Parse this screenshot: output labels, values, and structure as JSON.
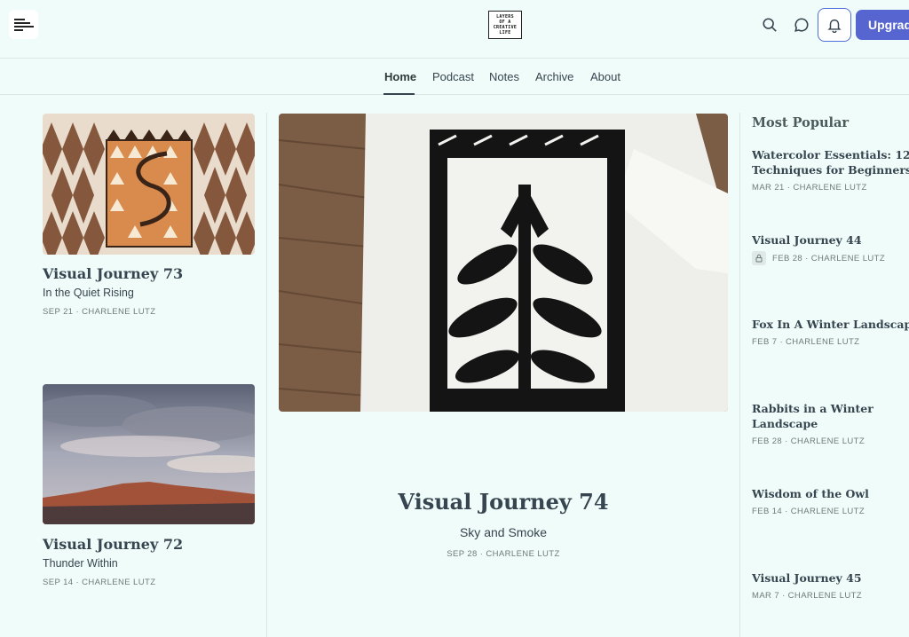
{
  "header": {
    "logo_left_alt": "LAYERS OF A CREATIVE LIFE",
    "logo_center_lines": [
      "LAYERS",
      "OF A",
      "CREATIVE",
      "LIFE"
    ],
    "icons": [
      "search-icon",
      "chat-icon",
      "bell-icon"
    ],
    "upgrade_label": "Upgrade"
  },
  "nav": {
    "items": [
      {
        "label": "Home",
        "active": true
      },
      {
        "label": "Podcast"
      },
      {
        "label": "Notes"
      },
      {
        "label": "Archive"
      },
      {
        "label": "About"
      }
    ]
  },
  "left_posts": [
    {
      "title": "Visual Journey 73",
      "subtitle": "In the Quiet Rising",
      "meta": "SEP 21 · CHARLENE LUTZ"
    },
    {
      "title": "Visual Journey 72",
      "subtitle": "Thunder Within",
      "meta": "SEP 14 · CHARLENE LUTZ"
    }
  ],
  "feature": {
    "title": "Visual Journey 74",
    "subtitle": "Sky and Smoke",
    "meta": "SEP 28 · CHARLENE LUTZ"
  },
  "popular": {
    "heading": "Most Popular",
    "items": [
      {
        "title_lines": [
          "Watercolor Essentials: 12",
          "Techniques for Beginners &..."
        ],
        "meta": "MAR 21 · CHARLENE LUTZ",
        "locked": false
      },
      {
        "title_lines": [
          "Visual Journey 44"
        ],
        "meta": "FEB 28 · CHARLENE LUTZ",
        "locked": true
      },
      {
        "title_lines": [
          "Fox In A Winter Landscape"
        ],
        "meta": "FEB 7 · CHARLENE LUTZ",
        "locked": false
      },
      {
        "title_lines": [
          "Rabbits in a Winter",
          "Landscape"
        ],
        "meta": "FEB 28 · CHARLENE LUTZ",
        "locked": false
      },
      {
        "title_lines": [
          "Wisdom of the Owl"
        ],
        "meta": "FEB 14 · CHARLENE LUTZ",
        "locked": false
      },
      {
        "title_lines": [
          "Visual Journey 45"
        ],
        "meta": "MAR 7 · CHARLENE LUTZ",
        "locked": false
      }
    ]
  },
  "colors": {
    "background": "#f0fcfa",
    "accent": "#5765d1",
    "text": "#36454f",
    "meta": "#6c7b7b"
  }
}
